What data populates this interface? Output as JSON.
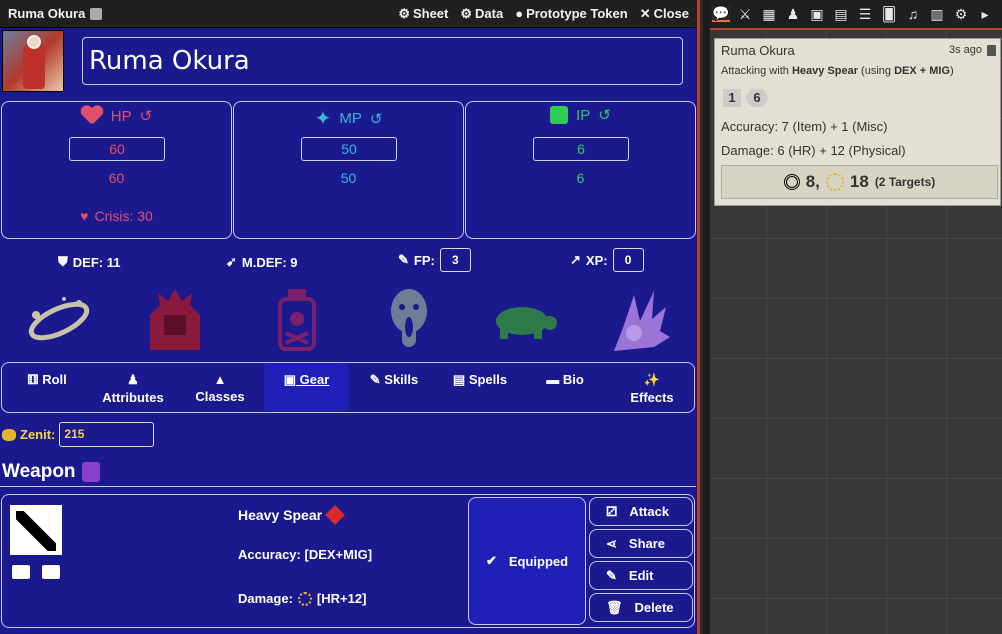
{
  "titlebar": {
    "actor_name": "Ruma Okura",
    "sheet_label": "Sheet",
    "data_label": "Data",
    "prototype_label": "Prototype Token",
    "close_label": "Close"
  },
  "character": {
    "name": "Ruma Okura"
  },
  "stats": {
    "hp": {
      "label": "HP",
      "value": "60",
      "max": "60",
      "crisis": "Crisis: 30",
      "color": "#e0506a"
    },
    "mp": {
      "label": "MP",
      "value": "50",
      "max": "50",
      "color": "#37b7d6"
    },
    "ip": {
      "label": "IP",
      "value": "6",
      "max": "6",
      "color": "#2fcc55"
    }
  },
  "defenses": {
    "def_label": "DEF: 11",
    "mdef_label": "M.DEF: 9",
    "fp_label": "FP:",
    "fp_value": "3",
    "xp_label": "XP:",
    "xp_value": "0"
  },
  "conditions": [
    "dazed-icon",
    "enraged-icon",
    "poisoned-icon",
    "shaken-icon",
    "slow-icon",
    "weak-icon"
  ],
  "tabs": [
    {
      "label": "Roll",
      "icon": "dice-icon"
    },
    {
      "label": "Attributes",
      "icon": "person-icon"
    },
    {
      "label": "Classes",
      "icon": "hat-icon"
    },
    {
      "label": "Gear",
      "icon": "bag-icon",
      "active": true
    },
    {
      "label": "Skills",
      "icon": "pen-icon"
    },
    {
      "label": "Spells",
      "icon": "book-icon"
    },
    {
      "label": "Bio",
      "icon": "comment-icon"
    },
    {
      "label": "Effects",
      "icon": "wand-icon"
    }
  ],
  "zenit": {
    "label": "Zenit:",
    "value": "215"
  },
  "weapon_section": {
    "title": "Weapon"
  },
  "weapon": {
    "name": "Heavy Spear",
    "accuracy_label": "Accuracy:",
    "accuracy_value": "[DEX+MIG]",
    "damage_label": "Damage:",
    "damage_value": "[HR+12]",
    "equipped_label": "Equipped",
    "buttons": {
      "attack": "Attack",
      "share": "Share",
      "edit": "Edit",
      "delete": "Delete"
    }
  },
  "chat_message": {
    "speaker": "Ruma Okura",
    "time": "3s ago",
    "flavor_prefix": "Attacking with",
    "flavor_weapon": "Heavy Spear",
    "flavor_suffix_a": "(using",
    "flavor_attrs": "DEX + MIG",
    "flavor_suffix_b": ")",
    "dice": [
      "1",
      "6"
    ],
    "accuracy": "Accuracy: 7 (Item) + 1 (Misc)",
    "damage": "Damage: 6 (HR) + 12 (Physical)",
    "result_accuracy": "8,",
    "result_damage": "18",
    "result_targets": "(2 Targets)"
  }
}
